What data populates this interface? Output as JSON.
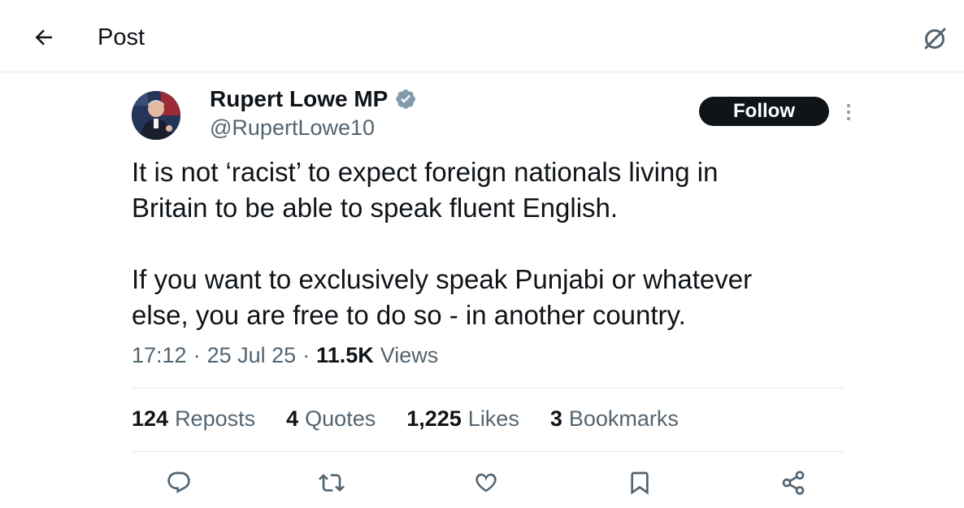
{
  "header": {
    "title": "Post",
    "back_icon": "arrow-left-icon",
    "grok_icon": "grok-icon"
  },
  "author": {
    "display_name": "Rupert Lowe MP",
    "handle": "@RupertLowe10",
    "verified_color": "#829aab"
  },
  "follow_label": "Follow",
  "tweet": {
    "text": "It is not ‘racist’ to expect foreign nationals living in\nBritain to be able to speak fluent English.\n\nIf you want to exclusively speak Punjabi or whatever\nelse, you are free to do so - in another country."
  },
  "meta": {
    "time": "17:12",
    "sep1": "·",
    "date": "25 Jul 25",
    "sep2": "·",
    "views_count": "11.5K",
    "views_label": "Views"
  },
  "stats": [
    {
      "count": "124",
      "label": "Reposts"
    },
    {
      "count": "4",
      "label": "Quotes"
    },
    {
      "count": "1,225",
      "label": "Likes"
    },
    {
      "count": "3",
      "label": "Bookmarks"
    }
  ],
  "actions": [
    "reply-icon",
    "repost-icon",
    "like-icon",
    "bookmark-icon",
    "share-icon"
  ],
  "colors": {
    "text": "#0f1419",
    "secondary": "#536471",
    "border": "#e6e9ec",
    "follow_bg": "#0f1419"
  }
}
